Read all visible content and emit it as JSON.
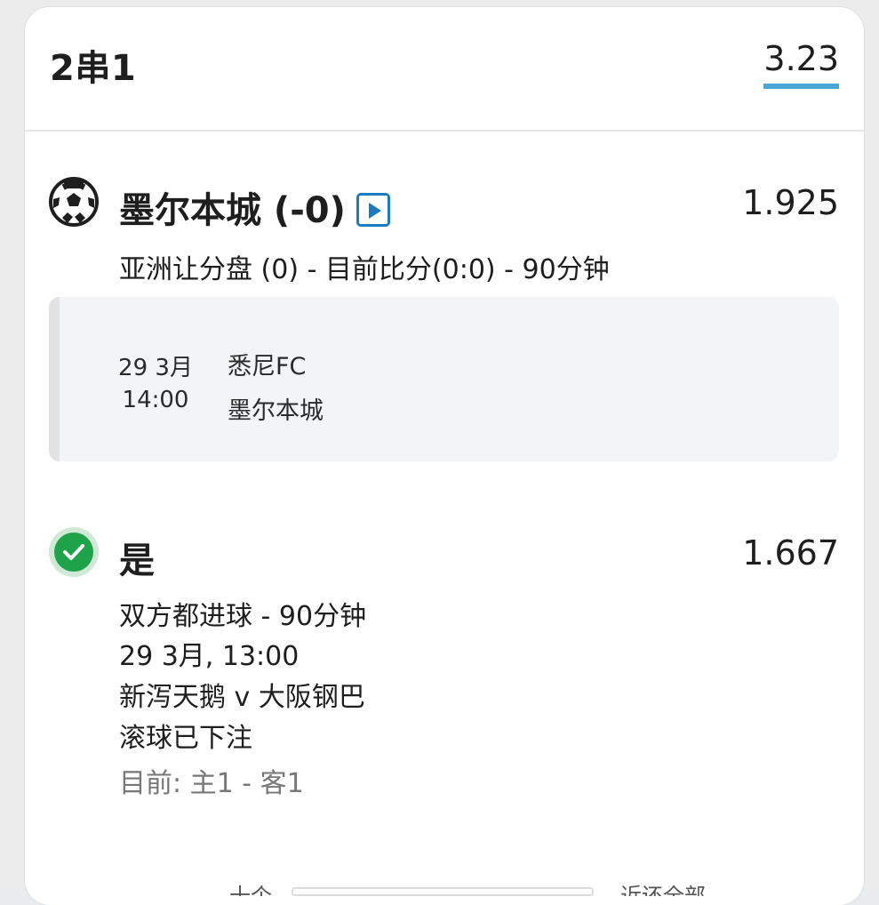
{
  "bet_slip": {
    "bet_type": "2串1",
    "total_odds": "3.23",
    "accent_color": "#4aa8d8"
  },
  "selection_1": {
    "icon": "soccer-ball-icon",
    "name": "墨尔本城 (-0)",
    "live_icon": "live-stream-icon",
    "odds": "1.925",
    "market": "亚洲让分盘 (0) - 目前比分(0:0) - 90分钟",
    "event": {
      "date": "29 3月",
      "time": "14:00",
      "team_home": "悉尼FC",
      "team_away": "墨尔本城"
    }
  },
  "selection_2": {
    "icon": "check-circle-icon",
    "status_color": "#1fa34a",
    "name": "是",
    "odds": "1.667",
    "market": "双方都进球 - 90分钟",
    "datetime": "29 3月, 13:00",
    "match": "新泻天鹅 v 大阪钢巴",
    "live_status": "滚球已下注",
    "current_score": "目前: 主1 - 客1"
  },
  "footer": {
    "left_text": "十个",
    "right_text": "近还全部"
  }
}
